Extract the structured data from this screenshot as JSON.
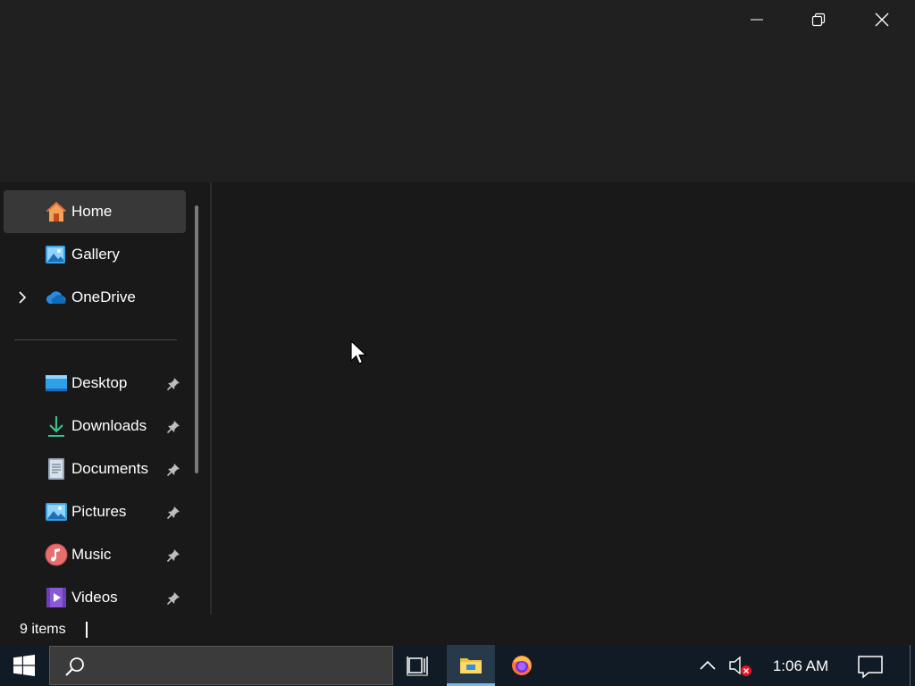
{
  "window": {
    "controls": {
      "minimize": "minimize-icon",
      "maximize": "restore-icon",
      "close": "close-icon"
    }
  },
  "sidebar": {
    "items": [
      {
        "label": "Home",
        "icon": "home-icon",
        "selected": true
      },
      {
        "label": "Gallery",
        "icon": "gallery-icon"
      },
      {
        "label": "OneDrive",
        "icon": "onedrive-icon",
        "expandable": true
      }
    ],
    "pinned": [
      {
        "label": "Desktop",
        "icon": "desktop-icon",
        "pinned": true
      },
      {
        "label": "Downloads",
        "icon": "downloads-icon",
        "pinned": true
      },
      {
        "label": "Documents",
        "icon": "documents-icon",
        "pinned": true
      },
      {
        "label": "Pictures",
        "icon": "pictures-icon",
        "pinned": true
      },
      {
        "label": "Music",
        "icon": "music-icon",
        "pinned": true
      },
      {
        "label": "Videos",
        "icon": "videos-icon",
        "pinned": true
      }
    ]
  },
  "status": {
    "item_count": "9 items"
  },
  "taskbar": {
    "apps": [
      "start-icon",
      "search-icon",
      "task-view-icon",
      "file-explorer-icon",
      "firefox-icon"
    ],
    "active_app": "file-explorer-icon",
    "clock": "1:06 AM",
    "volume_muted": true
  },
  "colors": {
    "background": "#202020",
    "pane": "#191919",
    "selected": "#383838",
    "taskbar": "#101b26",
    "accent": "#76b9ed"
  }
}
